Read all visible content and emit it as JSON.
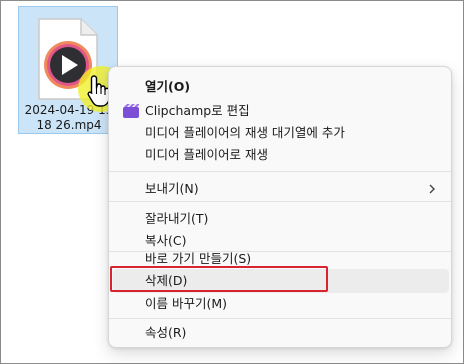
{
  "file": {
    "name_line1": "2024-04-19 13",
    "name_line2": "18 26.mp4",
    "icon": "media-play-file-icon"
  },
  "context_menu": {
    "items": [
      {
        "label": "열기(O)",
        "bold": true
      },
      {
        "label": "Clipchamp로 편집",
        "icon": "clipchamp-icon"
      },
      {
        "label": "미디어 플레이어의 재생 대기열에 추가"
      },
      {
        "label": "미디어 플레이어로 재생"
      },
      {
        "label": "보내기(N)",
        "submenu": true
      },
      {
        "label": "잘라내기(T)"
      },
      {
        "label": "복사(C)"
      },
      {
        "label": "바로 가기 만들기(S)"
      },
      {
        "label": "삭제(D)",
        "highlighted": true
      },
      {
        "label": "이름 바꾸기(M)"
      },
      {
        "label": "속성(R)"
      }
    ]
  },
  "colors": {
    "selection_bg": "#cce4f7",
    "highlight_box": "#d8242f",
    "cursor_halo": "#f0f028"
  }
}
